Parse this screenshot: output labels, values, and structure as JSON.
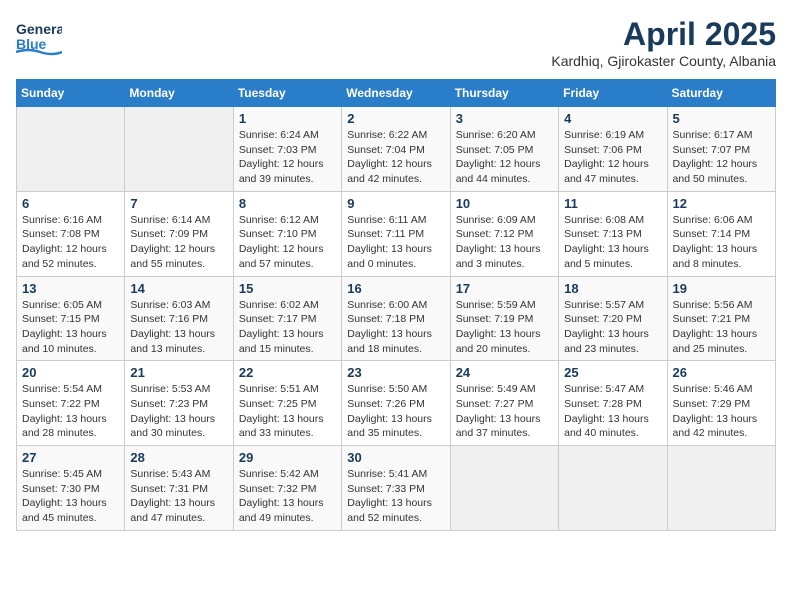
{
  "header": {
    "logo_line1": "General",
    "logo_line2": "Blue",
    "month": "April 2025",
    "location": "Kardhiq, Gjirokaster County, Albania"
  },
  "weekdays": [
    "Sunday",
    "Monday",
    "Tuesday",
    "Wednesday",
    "Thursday",
    "Friday",
    "Saturday"
  ],
  "weeks": [
    [
      {
        "day": "",
        "info": ""
      },
      {
        "day": "",
        "info": ""
      },
      {
        "day": "1",
        "info": "Sunrise: 6:24 AM\nSunset: 7:03 PM\nDaylight: 12 hours and 39 minutes."
      },
      {
        "day": "2",
        "info": "Sunrise: 6:22 AM\nSunset: 7:04 PM\nDaylight: 12 hours and 42 minutes."
      },
      {
        "day": "3",
        "info": "Sunrise: 6:20 AM\nSunset: 7:05 PM\nDaylight: 12 hours and 44 minutes."
      },
      {
        "day": "4",
        "info": "Sunrise: 6:19 AM\nSunset: 7:06 PM\nDaylight: 12 hours and 47 minutes."
      },
      {
        "day": "5",
        "info": "Sunrise: 6:17 AM\nSunset: 7:07 PM\nDaylight: 12 hours and 50 minutes."
      }
    ],
    [
      {
        "day": "6",
        "info": "Sunrise: 6:16 AM\nSunset: 7:08 PM\nDaylight: 12 hours and 52 minutes."
      },
      {
        "day": "7",
        "info": "Sunrise: 6:14 AM\nSunset: 7:09 PM\nDaylight: 12 hours and 55 minutes."
      },
      {
        "day": "8",
        "info": "Sunrise: 6:12 AM\nSunset: 7:10 PM\nDaylight: 12 hours and 57 minutes."
      },
      {
        "day": "9",
        "info": "Sunrise: 6:11 AM\nSunset: 7:11 PM\nDaylight: 13 hours and 0 minutes."
      },
      {
        "day": "10",
        "info": "Sunrise: 6:09 AM\nSunset: 7:12 PM\nDaylight: 13 hours and 3 minutes."
      },
      {
        "day": "11",
        "info": "Sunrise: 6:08 AM\nSunset: 7:13 PM\nDaylight: 13 hours and 5 minutes."
      },
      {
        "day": "12",
        "info": "Sunrise: 6:06 AM\nSunset: 7:14 PM\nDaylight: 13 hours and 8 minutes."
      }
    ],
    [
      {
        "day": "13",
        "info": "Sunrise: 6:05 AM\nSunset: 7:15 PM\nDaylight: 13 hours and 10 minutes."
      },
      {
        "day": "14",
        "info": "Sunrise: 6:03 AM\nSunset: 7:16 PM\nDaylight: 13 hours and 13 minutes."
      },
      {
        "day": "15",
        "info": "Sunrise: 6:02 AM\nSunset: 7:17 PM\nDaylight: 13 hours and 15 minutes."
      },
      {
        "day": "16",
        "info": "Sunrise: 6:00 AM\nSunset: 7:18 PM\nDaylight: 13 hours and 18 minutes."
      },
      {
        "day": "17",
        "info": "Sunrise: 5:59 AM\nSunset: 7:19 PM\nDaylight: 13 hours and 20 minutes."
      },
      {
        "day": "18",
        "info": "Sunrise: 5:57 AM\nSunset: 7:20 PM\nDaylight: 13 hours and 23 minutes."
      },
      {
        "day": "19",
        "info": "Sunrise: 5:56 AM\nSunset: 7:21 PM\nDaylight: 13 hours and 25 minutes."
      }
    ],
    [
      {
        "day": "20",
        "info": "Sunrise: 5:54 AM\nSunset: 7:22 PM\nDaylight: 13 hours and 28 minutes."
      },
      {
        "day": "21",
        "info": "Sunrise: 5:53 AM\nSunset: 7:23 PM\nDaylight: 13 hours and 30 minutes."
      },
      {
        "day": "22",
        "info": "Sunrise: 5:51 AM\nSunset: 7:25 PM\nDaylight: 13 hours and 33 minutes."
      },
      {
        "day": "23",
        "info": "Sunrise: 5:50 AM\nSunset: 7:26 PM\nDaylight: 13 hours and 35 minutes."
      },
      {
        "day": "24",
        "info": "Sunrise: 5:49 AM\nSunset: 7:27 PM\nDaylight: 13 hours and 37 minutes."
      },
      {
        "day": "25",
        "info": "Sunrise: 5:47 AM\nSunset: 7:28 PM\nDaylight: 13 hours and 40 minutes."
      },
      {
        "day": "26",
        "info": "Sunrise: 5:46 AM\nSunset: 7:29 PM\nDaylight: 13 hours and 42 minutes."
      }
    ],
    [
      {
        "day": "27",
        "info": "Sunrise: 5:45 AM\nSunset: 7:30 PM\nDaylight: 13 hours and 45 minutes."
      },
      {
        "day": "28",
        "info": "Sunrise: 5:43 AM\nSunset: 7:31 PM\nDaylight: 13 hours and 47 minutes."
      },
      {
        "day": "29",
        "info": "Sunrise: 5:42 AM\nSunset: 7:32 PM\nDaylight: 13 hours and 49 minutes."
      },
      {
        "day": "30",
        "info": "Sunrise: 5:41 AM\nSunset: 7:33 PM\nDaylight: 13 hours and 52 minutes."
      },
      {
        "day": "",
        "info": ""
      },
      {
        "day": "",
        "info": ""
      },
      {
        "day": "",
        "info": ""
      }
    ]
  ]
}
